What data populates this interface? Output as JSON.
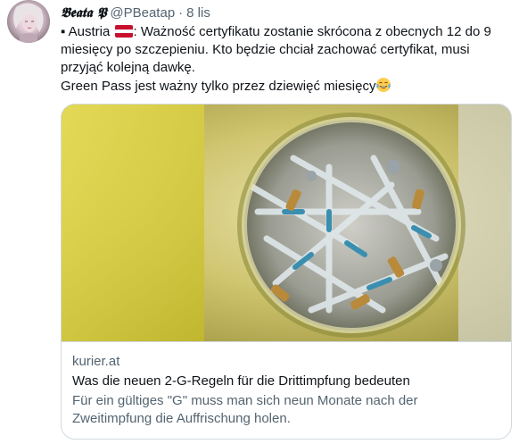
{
  "tweet": {
    "author": {
      "display_name": "𝕭𝖊𝖆𝖙𝖆 𝕻",
      "handle": "@PBeatap",
      "separator": "·",
      "timestamp": "8 lis"
    },
    "text": {
      "line1_prefix": "▪ Austria",
      "line1_suffix": ": Ważność certyfikatu zostanie skrócona z obecnych 12 do 9",
      "line2": "miesięcy po szczepieniu. Kto będzie chciał zachować certyfikat, musi",
      "line3": "przyjąć kolejną dawkę.",
      "line4": "Green Pass jest ważny tylko przez dziewięć miesięcy",
      "flag_icon": "austria-flag-icon",
      "emoji_icon": "face-with-tears-of-joy-icon"
    },
    "card": {
      "domain": "kurier.at",
      "title": "Was die neuen 2-G-Regeln für die Drittimpfung bedeuten",
      "description_line1": "Für ein gültiges \"G\" muss man sich neun Monate nach der",
      "description_line2": "Zweitimpfung die Auffrischung holen.",
      "image_subject": "syringes-in-sharps-container"
    },
    "colors": {
      "text_primary": "#0f1419",
      "text_secondary": "#536471",
      "border": "#cfd9de",
      "flag_red": "#c8102e",
      "flag_white": "#ffffff"
    }
  }
}
